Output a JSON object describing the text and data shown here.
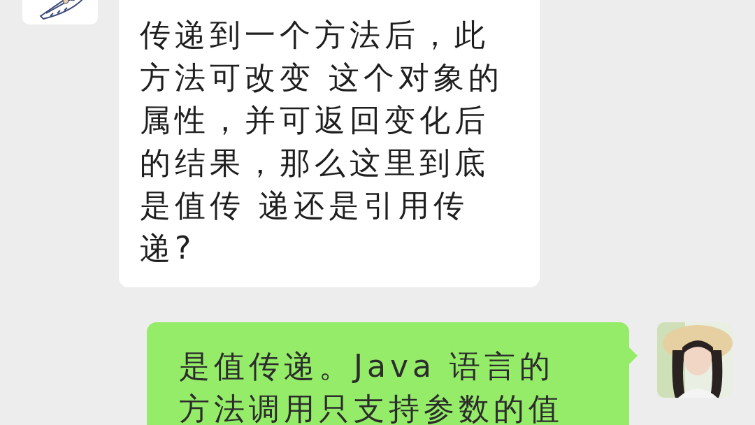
{
  "messages": [
    {
      "kind": "received",
      "lines": [
        "传递到一个方法后，此",
        "方法可改变 这个对象的",
        "属性，并可返回变化后",
        "的结果，那么这里到底",
        "是值传 递还是引用传",
        "递?"
      ]
    },
    {
      "kind": "sent",
      "lines": [
        "是值传递。Java 语言的",
        "方法调用只支持参数的值"
      ]
    }
  ]
}
